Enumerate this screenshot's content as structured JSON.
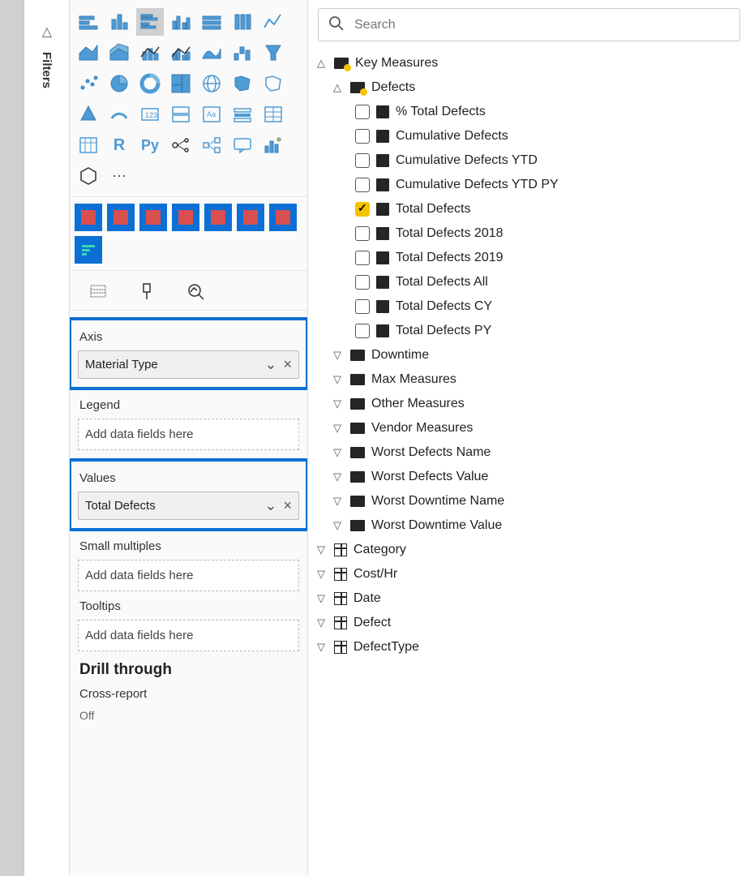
{
  "filters_rail_label": "Filters",
  "search": {
    "placeholder": "Search"
  },
  "wells": {
    "axis": {
      "label": "Axis",
      "field": "Material Type"
    },
    "legend": {
      "label": "Legend",
      "placeholder": "Add data fields here"
    },
    "values": {
      "label": "Values",
      "field": "Total Defects"
    },
    "small_multiples": {
      "label": "Small multiples",
      "placeholder": "Add data fields here"
    },
    "tooltips": {
      "label": "Tooltips",
      "placeholder": "Add data fields here"
    }
  },
  "drill_through": {
    "title": "Drill through",
    "cross_report": "Cross-report",
    "off": "Off"
  },
  "tree": {
    "key_measures": "Key Measures",
    "defects": "Defects",
    "measures": [
      {
        "label": "% Total Defects",
        "checked": false
      },
      {
        "label": "Cumulative Defects",
        "checked": false
      },
      {
        "label": "Cumulative Defects YTD",
        "checked": false
      },
      {
        "label": "Cumulative Defects YTD PY",
        "checked": false
      },
      {
        "label": "Total Defects",
        "checked": true
      },
      {
        "label": "Total Defects 2018",
        "checked": false
      },
      {
        "label": "Total Defects 2019",
        "checked": false
      },
      {
        "label": "Total Defects All",
        "checked": false
      },
      {
        "label": "Total Defects CY",
        "checked": false
      },
      {
        "label": "Total Defects PY",
        "checked": false
      }
    ],
    "folders": [
      "Downtime",
      "Max Measures",
      "Other Measures",
      "Vendor Measures",
      "Worst Defects Name",
      "Worst Defects Value",
      "Worst Downtime Name",
      "Worst Downtime Value"
    ],
    "tables": [
      "Category",
      "Cost/Hr",
      "Date",
      "Defect",
      "DefectType"
    ]
  }
}
